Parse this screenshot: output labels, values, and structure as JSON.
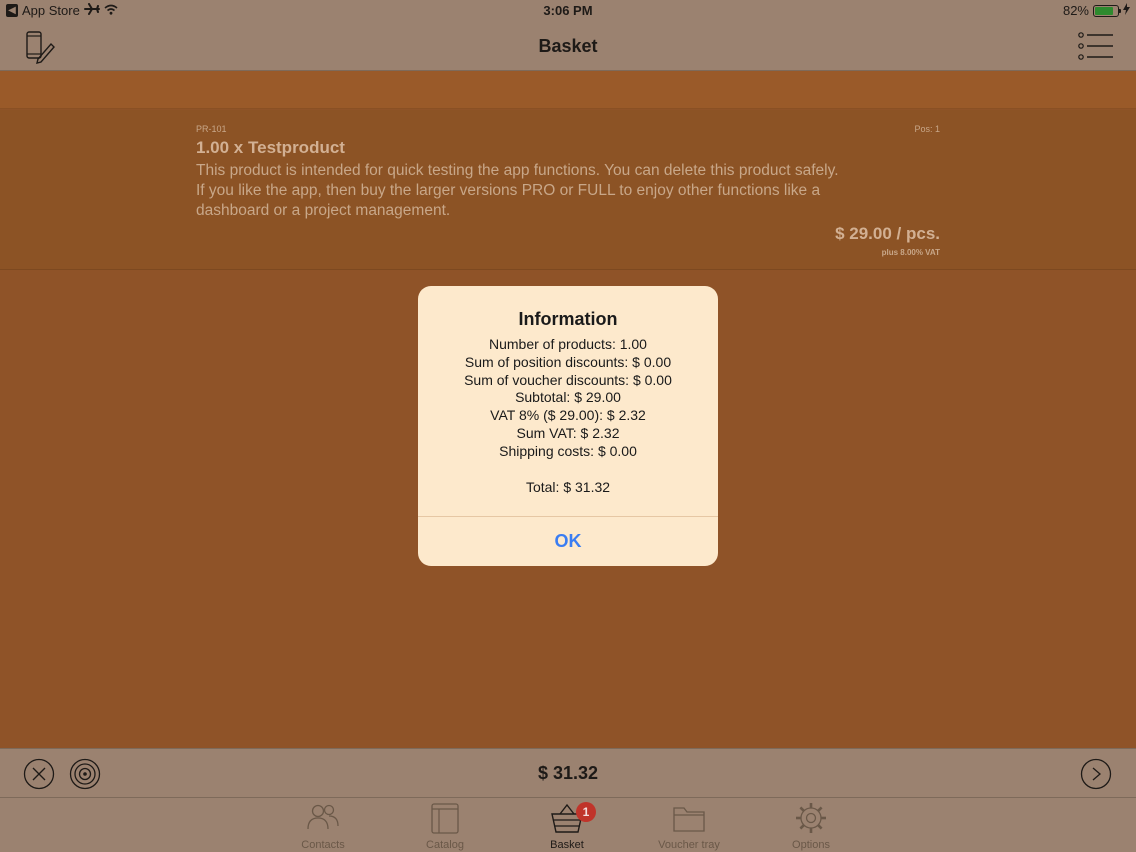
{
  "status_bar": {
    "back_app": "App Store",
    "time": "3:06 PM",
    "battery_percent": "82%",
    "battery_level": 0.82
  },
  "navbar": {
    "title": "Basket"
  },
  "product": {
    "code": "PR-101",
    "position": "Pos: 1",
    "name": "1.00 x Testproduct",
    "description_lines": [
      "This product is intended for quick testing the app functions. You can delete this product safely.",
      "If you like the app, then buy the larger versions PRO or FULL to enjoy other functions like a",
      "dashboard or a project management."
    ],
    "price": "$ 29.00 / pcs.",
    "vat_note": "plus 8.00% VAT"
  },
  "totalbar": {
    "total": "$ 31.32"
  },
  "tabs": [
    {
      "label": "Contacts",
      "icon": "contacts-icon",
      "active": false
    },
    {
      "label": "Catalog",
      "icon": "catalog-icon",
      "active": false
    },
    {
      "label": "Basket",
      "icon": "basket-icon",
      "active": true,
      "badge": "1"
    },
    {
      "label": "Voucher tray",
      "icon": "folder-icon",
      "active": false
    },
    {
      "label": "Options",
      "icon": "gear-icon",
      "active": false
    }
  ],
  "alert": {
    "title": "Information",
    "lines": [
      "Number of products: 1.00",
      "Sum of position discounts: $ 0.00",
      "Sum of voucher discounts: $ 0.00",
      "Subtotal: $ 29.00",
      "VAT 8% ($ 29.00): $ 2.32",
      "Sum VAT: $ 2.32",
      "Shipping costs: $ 0.00"
    ],
    "total_line": "Total: $ 31.32",
    "ok_label": "OK"
  },
  "colors": {
    "accent_blue": "#3a7df2",
    "badge_red": "#c0342a",
    "dimmed_orange": "#8f5328",
    "alert_background": "#fde9cc"
  }
}
